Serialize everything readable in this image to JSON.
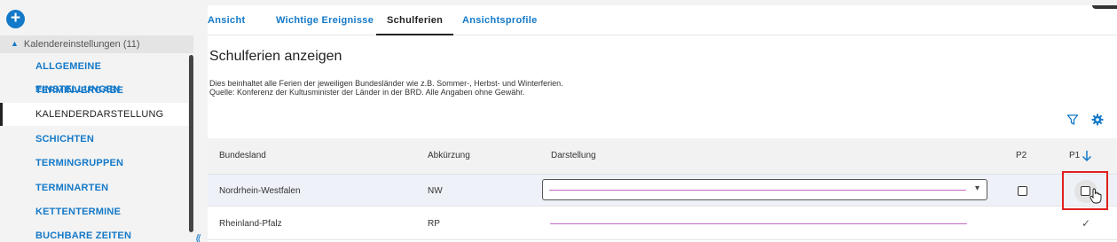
{
  "sidebar": {
    "add_label": "+",
    "section_title": "Kalendereinstellungen (11)",
    "items": [
      {
        "label": "ALLGEMEINE EINSTELLUNGEN"
      },
      {
        "label": "TERMINVERGABE"
      },
      {
        "label": "KALENDERDARSTELLUNG"
      },
      {
        "label": "SCHICHTEN"
      },
      {
        "label": "TERMINGRUPPEN"
      },
      {
        "label": "TERMINARTEN"
      },
      {
        "label": "KETTENTERMINE"
      },
      {
        "label": "BUCHBARE ZEITEN"
      }
    ],
    "active_item": "KALENDERDARSTELLUNG",
    "collapse_glyph": "⟪"
  },
  "tabs": [
    {
      "label": "Ansicht"
    },
    {
      "label": "Wichtige Ereignisse"
    },
    {
      "label": "Schulferien"
    },
    {
      "label": "Ansichtsprofile"
    }
  ],
  "active_tab": "Schulferien",
  "page": {
    "title": "Schulferien anzeigen",
    "desc_line1": "Dies beinhaltet alle Ferien der jeweiligen Bundesländer wie z.B. Sommer-, Herbst- und Winterferien.",
    "desc_line2": "Quelle: Konferenz der Kultusminister der Länder in der BRD. Alle Angaben ohne Gewähr."
  },
  "table": {
    "headers": {
      "bundesland": "Bundesland",
      "abkuerzung": "Abkürzung",
      "darstellung": "Darstellung",
      "p2": "P2",
      "p1": "P1"
    },
    "rows": [
      {
        "bundesland": "Nordrhein-Westfalen",
        "abkuerzung": "NW",
        "p2_checked": false,
        "p1_checked": false
      },
      {
        "bundesland": "Rheinland-Pfalz",
        "abkuerzung": "RP",
        "p1_check_glyph": "✓"
      }
    ]
  },
  "colors": {
    "accent": "#1479c8",
    "line": "#c66bc7",
    "highlight_box": "#e02020"
  },
  "icons": {
    "filter": "filter-icon",
    "settings": "gear-icon",
    "sort": "arrow-down-icon",
    "dropdown": "chevron-down-icon",
    "cursor": "hand-pointer-icon"
  }
}
